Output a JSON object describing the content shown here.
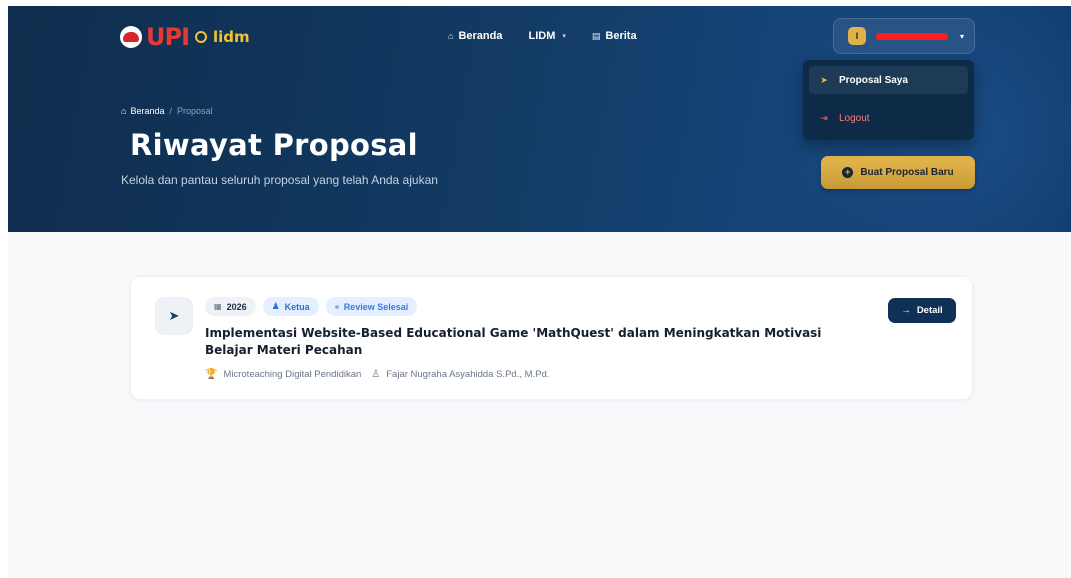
{
  "brand": {
    "logo_text": "UPI",
    "product": "lidm"
  },
  "nav": [
    {
      "icon": "home-icon",
      "label": "Beranda"
    },
    {
      "icon": "",
      "label": "LIDM",
      "has_dropdown": true
    },
    {
      "icon": "newspaper-icon",
      "label": "Berita"
    }
  ],
  "user": {
    "initial": "I",
    "name_redacted": true
  },
  "user_menu": {
    "items": [
      {
        "icon": "paper-plane-icon",
        "label": "Proposal Saya",
        "active": true
      },
      {
        "icon": "logout-icon",
        "label": "Logout"
      }
    ]
  },
  "breadcrumb": {
    "home": "Beranda",
    "separator": "/",
    "current": "Proposal"
  },
  "page": {
    "title": "Riwayat Proposal",
    "subtitle": "Kelola dan pantau seluruh proposal yang telah Anda ajukan"
  },
  "actions": {
    "new_proposal": "Buat Proposal Baru"
  },
  "proposals": [
    {
      "year": "2026",
      "role": "Ketua",
      "status": "Review Selesai",
      "title": "Implementasi Website-Based Educational Game 'MathQuest' dalam Meningkatkan Motivasi Belajar Materi Pecahan",
      "category": "Microteaching Digital Pendidikan",
      "advisor": "Fajar Nugraha Asyahidda S.Pd., M.Pd.",
      "detail_label": "Detail"
    }
  ],
  "colors": {
    "hero_dark": "#0f2d4d",
    "hero_light": "#16457a",
    "accent_gold": "#e0b24a",
    "primary_navy": "#0f3057",
    "badge_blue": "#2f6fd2",
    "logout_red": "#ff6b6b"
  }
}
